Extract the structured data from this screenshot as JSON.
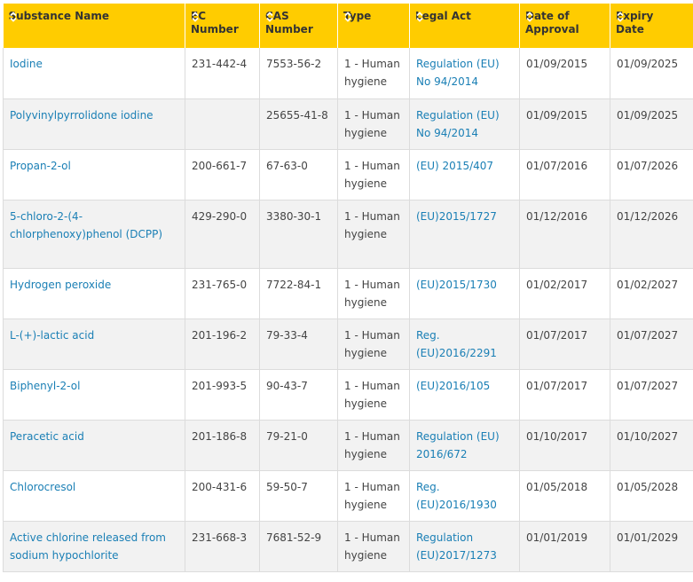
{
  "colors": {
    "header_bg": "#ffcc00",
    "header_text": "#333333",
    "link": "#1a7fb5",
    "row_alt": "#f2f2f2",
    "sort_icon": "#ffffff"
  },
  "table": {
    "headers": [
      {
        "label": "Substance Name",
        "icon": "sort-icon"
      },
      {
        "label": "EC Number",
        "icon": "sort-icon"
      },
      {
        "label": "CAS Number",
        "icon": "sort-icon"
      },
      {
        "label": "Type",
        "icon": "sort-icon"
      },
      {
        "label": "Legal Act",
        "icon": "sort-icon"
      },
      {
        "label": "Date of Approval",
        "icon": "sort-icon"
      },
      {
        "label": "Expiry Date",
        "icon": "sort-icon"
      }
    ],
    "rows": [
      {
        "name": "Iodine",
        "ec": "231-442-4",
        "cas": "7553-56-2",
        "type": "1 - Human hygiene",
        "act": "Regulation (EU) No 94/2014",
        "approval": "01/09/2015",
        "expiry": "01/09/2025"
      },
      {
        "name": "Polyvinylpyrrolidone iodine",
        "ec": "",
        "cas": "25655-41-8",
        "type": "1 - Human hygiene",
        "act": "Regulation (EU) No 94/2014",
        "approval": "01/09/2015",
        "expiry": "01/09/2025"
      },
      {
        "name": "Propan-2-ol",
        "ec": "200-661-7",
        "cas": "67-63-0",
        "type": "1 - Human hygiene",
        "act": "(EU) 2015/407",
        "approval": "01/07/2016",
        "expiry": "01/07/2026"
      },
      {
        "name": "5-chloro-2-(4-chlorphenoxy)phenol (DCPP)",
        "ec": "429-290-0",
        "cas": "3380-30-1",
        "type": "1 - Human hygiene",
        "act": "(EU)2015/1727",
        "approval": "01/12/2016",
        "expiry": "01/12/2026"
      },
      {
        "name": "Hydrogen peroxide",
        "ec": "231-765-0",
        "cas": "7722-84-1",
        "type": "1 - Human hygiene",
        "act": "(EU)2015/1730",
        "approval": "01/02/2017",
        "expiry": "01/02/2027"
      },
      {
        "name": "L-(+)-lactic acid",
        "ec": "201-196-2",
        "cas": "79-33-4",
        "type": "1 - Human hygiene",
        "act": "Reg. (EU)2016/2291",
        "approval": "01/07/2017",
        "expiry": "01/07/2027"
      },
      {
        "name": "Biphenyl-2-ol",
        "ec": "201-993-5",
        "cas": "90-43-7",
        "type": "1 - Human hygiene",
        "act": "(EU)2016/105",
        "approval": "01/07/2017",
        "expiry": "01/07/2027"
      },
      {
        "name": "Peracetic acid",
        "ec": "201-186-8",
        "cas": "79-21-0",
        "type": "1 - Human hygiene",
        "act": "Regulation (EU) 2016/672",
        "approval": "01/10/2017",
        "expiry": "01/10/2027"
      },
      {
        "name": "Chlorocresol",
        "ec": "200-431-6",
        "cas": "59-50-7",
        "type": "1 - Human hygiene",
        "act": "Reg. (EU)2016/1930",
        "approval": "01/05/2018",
        "expiry": "01/05/2028"
      },
      {
        "name": "Active chlorine released from sodium hypochlorite",
        "ec": "231-668-3",
        "cas": "7681-52-9",
        "type": "1 - Human hygiene",
        "act": "Regulation (EU)2017/1273",
        "approval": "01/01/2019",
        "expiry": "01/01/2029"
      }
    ]
  }
}
